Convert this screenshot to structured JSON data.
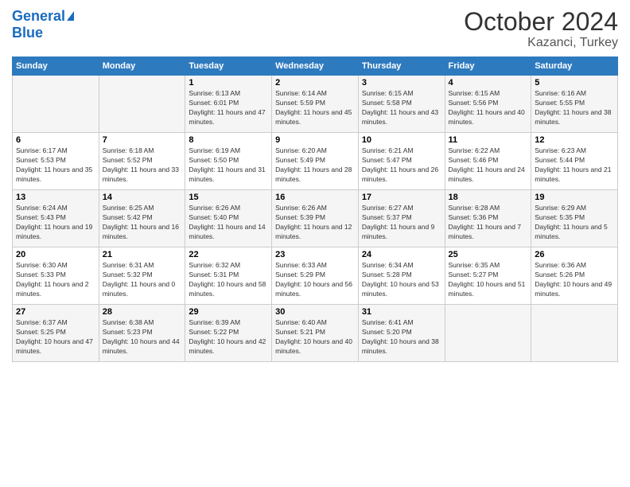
{
  "logo": {
    "line1": "General",
    "line2": "Blue"
  },
  "title": "October 2024",
  "subtitle": "Kazanci, Turkey",
  "days_header": [
    "Sunday",
    "Monday",
    "Tuesday",
    "Wednesday",
    "Thursday",
    "Friday",
    "Saturday"
  ],
  "weeks": [
    [
      {
        "day": "",
        "sunrise": "",
        "sunset": "",
        "daylight": ""
      },
      {
        "day": "",
        "sunrise": "",
        "sunset": "",
        "daylight": ""
      },
      {
        "day": "1",
        "sunrise": "Sunrise: 6:13 AM",
        "sunset": "Sunset: 6:01 PM",
        "daylight": "Daylight: 11 hours and 47 minutes."
      },
      {
        "day": "2",
        "sunrise": "Sunrise: 6:14 AM",
        "sunset": "Sunset: 5:59 PM",
        "daylight": "Daylight: 11 hours and 45 minutes."
      },
      {
        "day": "3",
        "sunrise": "Sunrise: 6:15 AM",
        "sunset": "Sunset: 5:58 PM",
        "daylight": "Daylight: 11 hours and 43 minutes."
      },
      {
        "day": "4",
        "sunrise": "Sunrise: 6:15 AM",
        "sunset": "Sunset: 5:56 PM",
        "daylight": "Daylight: 11 hours and 40 minutes."
      },
      {
        "day": "5",
        "sunrise": "Sunrise: 6:16 AM",
        "sunset": "Sunset: 5:55 PM",
        "daylight": "Daylight: 11 hours and 38 minutes."
      }
    ],
    [
      {
        "day": "6",
        "sunrise": "Sunrise: 6:17 AM",
        "sunset": "Sunset: 5:53 PM",
        "daylight": "Daylight: 11 hours and 35 minutes."
      },
      {
        "day": "7",
        "sunrise": "Sunrise: 6:18 AM",
        "sunset": "Sunset: 5:52 PM",
        "daylight": "Daylight: 11 hours and 33 minutes."
      },
      {
        "day": "8",
        "sunrise": "Sunrise: 6:19 AM",
        "sunset": "Sunset: 5:50 PM",
        "daylight": "Daylight: 11 hours and 31 minutes."
      },
      {
        "day": "9",
        "sunrise": "Sunrise: 6:20 AM",
        "sunset": "Sunset: 5:49 PM",
        "daylight": "Daylight: 11 hours and 28 minutes."
      },
      {
        "day": "10",
        "sunrise": "Sunrise: 6:21 AM",
        "sunset": "Sunset: 5:47 PM",
        "daylight": "Daylight: 11 hours and 26 minutes."
      },
      {
        "day": "11",
        "sunrise": "Sunrise: 6:22 AM",
        "sunset": "Sunset: 5:46 PM",
        "daylight": "Daylight: 11 hours and 24 minutes."
      },
      {
        "day": "12",
        "sunrise": "Sunrise: 6:23 AM",
        "sunset": "Sunset: 5:44 PM",
        "daylight": "Daylight: 11 hours and 21 minutes."
      }
    ],
    [
      {
        "day": "13",
        "sunrise": "Sunrise: 6:24 AM",
        "sunset": "Sunset: 5:43 PM",
        "daylight": "Daylight: 11 hours and 19 minutes."
      },
      {
        "day": "14",
        "sunrise": "Sunrise: 6:25 AM",
        "sunset": "Sunset: 5:42 PM",
        "daylight": "Daylight: 11 hours and 16 minutes."
      },
      {
        "day": "15",
        "sunrise": "Sunrise: 6:26 AM",
        "sunset": "Sunset: 5:40 PM",
        "daylight": "Daylight: 11 hours and 14 minutes."
      },
      {
        "day": "16",
        "sunrise": "Sunrise: 6:26 AM",
        "sunset": "Sunset: 5:39 PM",
        "daylight": "Daylight: 11 hours and 12 minutes."
      },
      {
        "day": "17",
        "sunrise": "Sunrise: 6:27 AM",
        "sunset": "Sunset: 5:37 PM",
        "daylight": "Daylight: 11 hours and 9 minutes."
      },
      {
        "day": "18",
        "sunrise": "Sunrise: 6:28 AM",
        "sunset": "Sunset: 5:36 PM",
        "daylight": "Daylight: 11 hours and 7 minutes."
      },
      {
        "day": "19",
        "sunrise": "Sunrise: 6:29 AM",
        "sunset": "Sunset: 5:35 PM",
        "daylight": "Daylight: 11 hours and 5 minutes."
      }
    ],
    [
      {
        "day": "20",
        "sunrise": "Sunrise: 6:30 AM",
        "sunset": "Sunset: 5:33 PM",
        "daylight": "Daylight: 11 hours and 2 minutes."
      },
      {
        "day": "21",
        "sunrise": "Sunrise: 6:31 AM",
        "sunset": "Sunset: 5:32 PM",
        "daylight": "Daylight: 11 hours and 0 minutes."
      },
      {
        "day": "22",
        "sunrise": "Sunrise: 6:32 AM",
        "sunset": "Sunset: 5:31 PM",
        "daylight": "Daylight: 10 hours and 58 minutes."
      },
      {
        "day": "23",
        "sunrise": "Sunrise: 6:33 AM",
        "sunset": "Sunset: 5:29 PM",
        "daylight": "Daylight: 10 hours and 56 minutes."
      },
      {
        "day": "24",
        "sunrise": "Sunrise: 6:34 AM",
        "sunset": "Sunset: 5:28 PM",
        "daylight": "Daylight: 10 hours and 53 minutes."
      },
      {
        "day": "25",
        "sunrise": "Sunrise: 6:35 AM",
        "sunset": "Sunset: 5:27 PM",
        "daylight": "Daylight: 10 hours and 51 minutes."
      },
      {
        "day": "26",
        "sunrise": "Sunrise: 6:36 AM",
        "sunset": "Sunset: 5:26 PM",
        "daylight": "Daylight: 10 hours and 49 minutes."
      }
    ],
    [
      {
        "day": "27",
        "sunrise": "Sunrise: 6:37 AM",
        "sunset": "Sunset: 5:25 PM",
        "daylight": "Daylight: 10 hours and 47 minutes."
      },
      {
        "day": "28",
        "sunrise": "Sunrise: 6:38 AM",
        "sunset": "Sunset: 5:23 PM",
        "daylight": "Daylight: 10 hours and 44 minutes."
      },
      {
        "day": "29",
        "sunrise": "Sunrise: 6:39 AM",
        "sunset": "Sunset: 5:22 PM",
        "daylight": "Daylight: 10 hours and 42 minutes."
      },
      {
        "day": "30",
        "sunrise": "Sunrise: 6:40 AM",
        "sunset": "Sunset: 5:21 PM",
        "daylight": "Daylight: 10 hours and 40 minutes."
      },
      {
        "day": "31",
        "sunrise": "Sunrise: 6:41 AM",
        "sunset": "Sunset: 5:20 PM",
        "daylight": "Daylight: 10 hours and 38 minutes."
      },
      {
        "day": "",
        "sunrise": "",
        "sunset": "",
        "daylight": ""
      },
      {
        "day": "",
        "sunrise": "",
        "sunset": "",
        "daylight": ""
      }
    ]
  ]
}
